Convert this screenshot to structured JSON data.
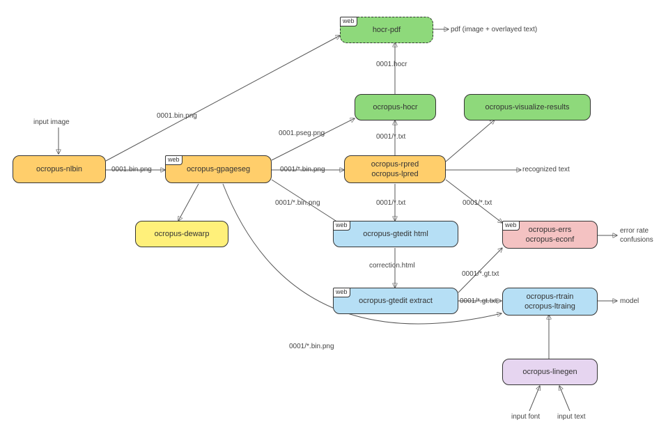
{
  "nodes": {
    "nlbin": {
      "label": "ocropus-nlbin"
    },
    "gpageseg": {
      "label": "ocropus-gpageseg",
      "web": "web"
    },
    "rpred": {
      "line1": "ocropus-rpred",
      "line2": "ocropus-lpred"
    },
    "dewarp": {
      "label": "ocropus-dewarp"
    },
    "hocr": {
      "label": "ocropus-hocr"
    },
    "vis": {
      "label": "ocropus-visualize-results"
    },
    "hocrpdf": {
      "label": "hocr-pdf",
      "web": "web"
    },
    "gtedit_html": {
      "label": "ocropus-gtedit html",
      "web": "web"
    },
    "gtedit_ext": {
      "label": "ocropus-gtedit extract",
      "web": "web"
    },
    "errs": {
      "line1": "ocropus-errs",
      "line2": "ocropus-econf",
      "web": "web"
    },
    "rtrain": {
      "line1": "ocropus-rtrain",
      "line2": "ocropus-ltraing"
    },
    "linegen": {
      "label": "ocropus-linegen"
    }
  },
  "ext": {
    "input_image": "input image",
    "pdf_out": "pdf (image + overlayed text)",
    "recognized": "recognized text",
    "err_out_1": "error rate",
    "err_out_2": "confusions",
    "model": "model",
    "input_font": "input font",
    "input_text": "input text"
  },
  "edges": {
    "e1": "0001.bin.png",
    "e2": "0001.bin.png",
    "e3": "0001/*.bin.png",
    "e4": "0001.pseg.png",
    "e5": "0001/*.txt",
    "e6": "0001.hocr",
    "e7": "0001/*.bin.png",
    "e8": "0001/*.txt",
    "e9": "0001/*.txt",
    "e10": "correction.html",
    "e11": "0001/*.gt.txt",
    "e12": "0001/*.gt.txt",
    "e13": "0001/*.bin.png"
  }
}
